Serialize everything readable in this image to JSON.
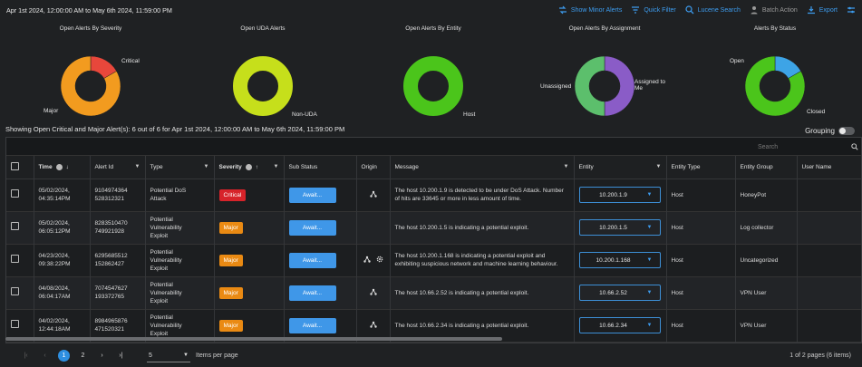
{
  "header": {
    "date_range": "Apr 1st 2024, 12:00:00 AM to May 6th 2024, 11:59:00 PM",
    "tools": [
      {
        "label": "Show Minor Alerts",
        "icon": "minor-alerts-icon"
      },
      {
        "label": "Quick Filter",
        "icon": "filter-icon"
      },
      {
        "label": "Lucene Search",
        "icon": "search-icon"
      },
      {
        "label": "Batch Action",
        "icon": "batch-action-icon"
      },
      {
        "label": "Export",
        "icon": "export-icon"
      },
      {
        "label": "",
        "icon": "settings-icon"
      }
    ]
  },
  "charts": [
    {
      "title": "Open Alerts By Severity",
      "slices": [
        {
          "label": "Critical",
          "value": 1,
          "color": "#e8473b"
        },
        {
          "label": "Major",
          "value": 5,
          "color": "#f29b1f"
        }
      ]
    },
    {
      "title": "Open UDA Alerts",
      "slices": [
        {
          "label": "Non-UDA",
          "value": 6,
          "color": "#c6df1b"
        }
      ]
    },
    {
      "title": "Open Alerts By Entity",
      "slices": [
        {
          "label": "Host",
          "value": 6,
          "color": "#4bc51b"
        }
      ]
    },
    {
      "title": "Open Alerts By Assignment",
      "slices": [
        {
          "label": "Unassigned",
          "value": 3,
          "color": "#8a5cc7"
        },
        {
          "label": "Assigned to Me",
          "value": 3,
          "color": "#5cbf6c"
        }
      ]
    },
    {
      "title": "Alerts By Status",
      "slices": [
        {
          "label": "Open",
          "value": 1,
          "color": "#3da4e6"
        },
        {
          "label": "Closed",
          "value": 5,
          "color": "#4bc51b"
        }
      ]
    }
  ],
  "summary": "Showing Open Critical and Major Alert(s): 6 out of 6 for Apr 1st 2024, 12:00:00 AM to May 6th 2024, 11:59:00 PM",
  "grouping_label": "Grouping",
  "search_placeholder": "Search",
  "columns": {
    "time": "Time",
    "alert_id": "Alert Id",
    "type": "Type",
    "severity": "Severity",
    "sub_status": "Sub Status",
    "origin": "Origin",
    "message": "Message",
    "entity": "Entity",
    "entity_type": "Entity Type",
    "entity_group": "Entity Group",
    "user_name": "User Name"
  },
  "rows": [
    {
      "time": "05/02/2024,\n04:35:14PM",
      "alert_id": "9104974364\n528312321",
      "type": "Potential DoS\nAttack",
      "severity": "Critical",
      "sub_status": "Await...",
      "origin": [
        "topology-icon"
      ],
      "message": "The host 10.200.1.9 is detected to be under DoS Attack. Number of hits are 33645 or more in less amount of time.",
      "entity": "10.200.1.9",
      "entity_type": "Host",
      "entity_group": "HoneyPot"
    },
    {
      "time": "05/02/2024,\n06:05:12PM",
      "alert_id": "8283510470\n749921928",
      "type": "Potential\nVulnerability\nExploit",
      "severity": "Major",
      "sub_status": "Await...",
      "origin": [],
      "message": "The host 10.200.1.5 is indicating a potential exploit.",
      "entity": "10.200.1.5",
      "entity_type": "Host",
      "entity_group": "Log collector"
    },
    {
      "time": "04/23/2024,\n09:38:22PM",
      "alert_id": "6295685512\n152862427",
      "type": "Potential\nVulnerability\nExploit",
      "severity": "Major",
      "sub_status": "Await...",
      "origin": [
        "topology-icon",
        "ml-gear-icon"
      ],
      "message": "The host 10.200.1.168 is indicating a potential exploit and exhibiting suspicious network and machine learning behaviour.",
      "entity": "10.200.1.168",
      "entity_type": "Host",
      "entity_group": "Uncategorized"
    },
    {
      "time": "04/08/2024,\n06:04:17AM",
      "alert_id": "7074547627\n193372765",
      "type": "Potential\nVulnerability\nExploit",
      "severity": "Major",
      "sub_status": "Await...",
      "origin": [
        "topology-icon"
      ],
      "message": "The host 10.66.2.52 is indicating a potential exploit.",
      "entity": "10.66.2.52",
      "entity_type": "Host",
      "entity_group": "VPN User"
    },
    {
      "time": "04/02/2024,\n12:44:18AM",
      "alert_id": "8984965876\n471520321",
      "type": "Potential\nVulnerability\nExploit",
      "severity": "Major",
      "sub_status": "Await...",
      "origin": [
        "topology-icon"
      ],
      "message": "The host 10.66.2.34 is indicating a potential exploit.",
      "entity": "10.66.2.34",
      "entity_type": "Host",
      "entity_group": "VPN User"
    }
  ],
  "pager": {
    "pages": [
      "1",
      "2"
    ],
    "current": "1",
    "per_page": "5",
    "per_page_label": "Items per page",
    "info": "1 of 2 pages (6 items)"
  }
}
